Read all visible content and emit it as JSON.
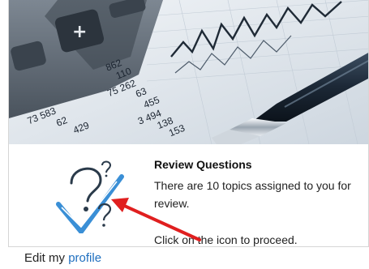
{
  "review": {
    "title": "Review Questions",
    "text": "There are 10 topics assigned to you for review.",
    "hint": "Click on the icon to proceed."
  },
  "hero_figures": {
    "calc_key": "+",
    "col1": [
      "862",
      "110",
      "75 262",
      "63",
      "455",
      "3 494",
      "138",
      "153"
    ],
    "col2": [
      "73 583",
      "62",
      "429"
    ]
  },
  "footer": {
    "edit_text": "Edit my",
    "profile_link": "profile"
  },
  "colors": {
    "link": "#1f6fbf",
    "icon_blue": "#3a8fd6",
    "arrow_red": "#e01f1f"
  },
  "icons": {
    "review": "question-check-icon",
    "pointer": "red-arrow"
  }
}
